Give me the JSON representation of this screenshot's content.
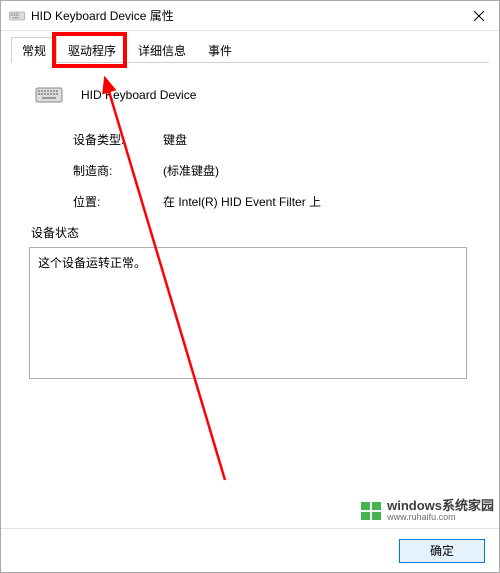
{
  "window": {
    "title": "HID Keyboard Device 属性"
  },
  "tabs": {
    "general": "常规",
    "driver": "驱动程序",
    "details": "详细信息",
    "events": "事件"
  },
  "device": {
    "name": "HID Keyboard Device"
  },
  "info": {
    "type_label": "设备类型:",
    "type_value": "键盘",
    "manufacturer_label": "制造商:",
    "manufacturer_value": "(标准键盘)",
    "location_label": "位置:",
    "location_value": "在 Intel(R) HID Event Filter 上"
  },
  "status": {
    "label": "设备状态",
    "text": "这个设备运转正常。"
  },
  "buttons": {
    "ok": "确定"
  },
  "watermark": {
    "main": "windows系统家园",
    "sub": "www.ruhaifu.com"
  },
  "colors": {
    "highlight": "#ff0000",
    "button_border": "#0078d7",
    "button_bg": "#e5f1fb"
  }
}
